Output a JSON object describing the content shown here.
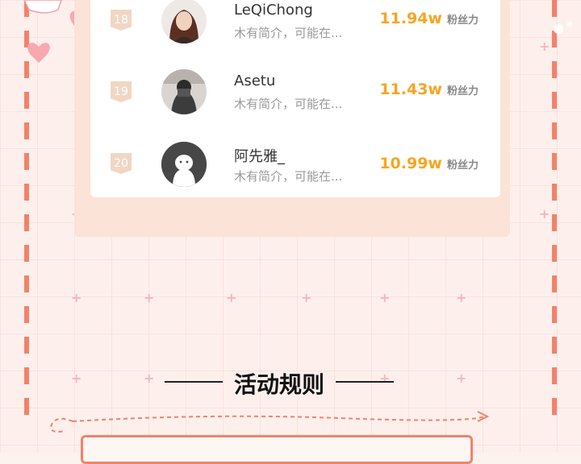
{
  "ranking": [
    {
      "rank": "18",
      "name": "LeQiChong",
      "intro": "木有简介，可能在...",
      "fans": "11.94w",
      "fans_label": "粉丝力"
    },
    {
      "rank": "19",
      "name": "Asetu",
      "intro": "木有简介，可能在...",
      "fans": "11.43w",
      "fans_label": "粉丝力"
    },
    {
      "rank": "20",
      "name": "阿先雅_",
      "intro": "木有简介，可能在...",
      "fans": "10.99w",
      "fans_label": "粉丝力"
    }
  ],
  "section": {
    "title": "活动规则"
  },
  "colors": {
    "accent": "#f5a623",
    "dash": "#f2826a",
    "panel": "#fbe3d7",
    "rank_badge": "#f1d6c4"
  }
}
